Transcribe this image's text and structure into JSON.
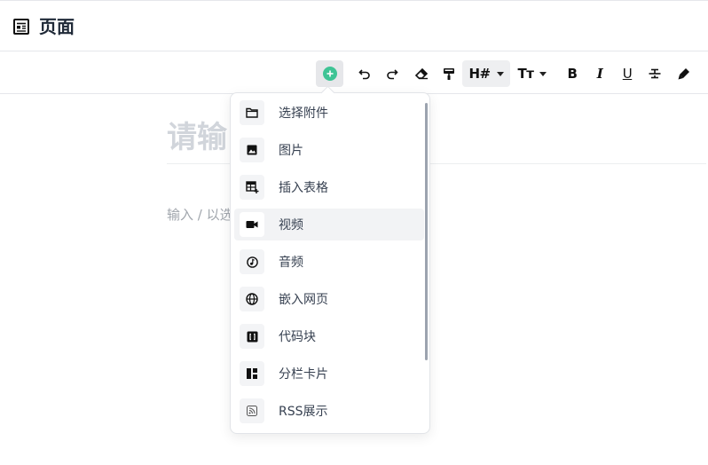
{
  "header": {
    "title": "页面",
    "icon": "page-icon"
  },
  "toolbar": {
    "heading_label": "H#",
    "fontsize_label": "Tт",
    "bold_label": "B",
    "italic_label": "I",
    "underline_label": "U",
    "accent_color": "#3ec495"
  },
  "editor": {
    "title_placeholder": "请输",
    "body_placeholder": "输入 / 以选"
  },
  "menu": {
    "items": [
      {
        "label": "选择附件",
        "icon": "folder-icon"
      },
      {
        "label": "图片",
        "icon": "image-icon"
      },
      {
        "label": "插入表格",
        "icon": "table-add-icon"
      },
      {
        "label": "视频",
        "icon": "video-icon",
        "hovered": true
      },
      {
        "label": "音频",
        "icon": "music-note-icon"
      },
      {
        "label": "嵌入网页",
        "icon": "globe-icon"
      },
      {
        "label": "代码块",
        "icon": "code-block-icon"
      },
      {
        "label": "分栏卡片",
        "icon": "columns-icon"
      },
      {
        "label": "RSS展示",
        "icon": "rss-icon"
      }
    ]
  }
}
